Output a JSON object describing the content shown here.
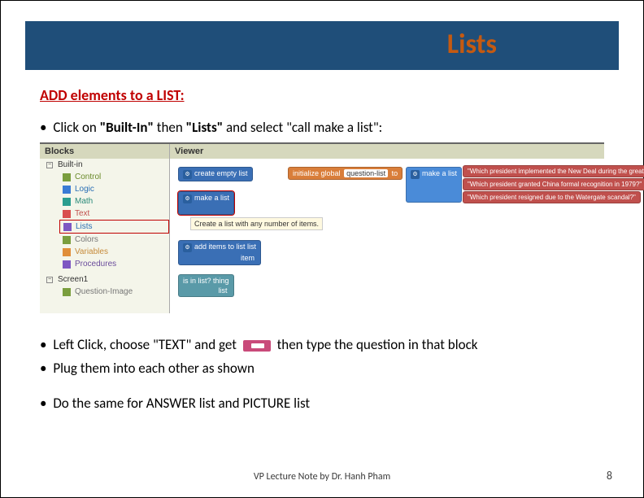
{
  "header": {
    "title": "Lists"
  },
  "section": {
    "heading": "ADD elements to a LIST:"
  },
  "bullets": {
    "b1_a": "Click on ",
    "b1_b": "\"Built-In\"",
    "b1_c": " then ",
    "b1_d": "\"Lists\"",
    "b1_e": " and select \"call make a list\":",
    "b2_a": "Left Click, choose \"TEXT\" and get",
    "b2_b": "then type the question in that block",
    "b3": "Plug them into each other as shown",
    "b4": "Do the same for ANSWER list and PICTURE list"
  },
  "panels": {
    "blocks": "Blocks",
    "viewer": "Viewer",
    "builtin": "Built-in",
    "items": {
      "control": "Control",
      "logic": "Logic",
      "math": "Math",
      "text": "Text",
      "lists": "Lists",
      "colors": "Colors",
      "variables": "Variables",
      "procedures": "Procedures"
    },
    "screen": "Screen1",
    "qimage": "Question-Image"
  },
  "blocks": {
    "create_empty": "create empty list",
    "make_list": "make a list",
    "tooltip": "Create a list with any number of items.",
    "add_items": "add items to list   list",
    "add_items_item": "item",
    "is_in_list": "is in list?   thing",
    "is_in_list_list": "list",
    "init_global": "initialize global",
    "question_list": "question-list",
    "to": "to",
    "q1": "Which president implemented the  New Deal  during the great depression?",
    "q2": "Which president granted China formal recognition in 1979?",
    "q3": "Which president resigned due to the Watergate scandal?",
    "blank": "\" \""
  },
  "footer": {
    "note": "VP Lecture Note by Dr. Hanh Pham",
    "page": "8"
  }
}
